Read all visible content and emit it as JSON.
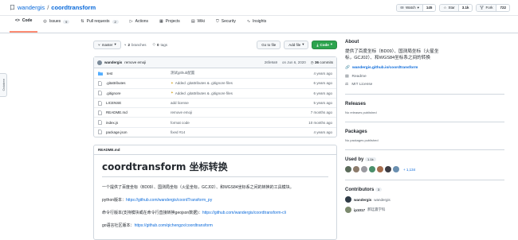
{
  "repo": {
    "owner": "wandergis",
    "separator": "/",
    "name": "coordtransform"
  },
  "actions": {
    "watch_label": "Watch",
    "watch_count": "145",
    "star_label": "Star",
    "star_count": "3.1k",
    "fork_label": "Fork",
    "fork_count": "722"
  },
  "tabs": [
    {
      "label": "Code",
      "icon": "code-icon"
    },
    {
      "label": "Issues",
      "count": "9",
      "icon": "issue-icon"
    },
    {
      "label": "Pull requests",
      "count": "2",
      "icon": "pull-request-icon"
    },
    {
      "label": "Actions",
      "icon": "play-icon"
    },
    {
      "label": "Projects",
      "icon": "table-icon"
    },
    {
      "label": "Wiki",
      "icon": "book-icon"
    },
    {
      "label": "Security",
      "icon": "shield-icon"
    },
    {
      "label": "Insights",
      "icon": "graph-icon"
    }
  ],
  "toolbar": {
    "branch": "master",
    "branches": "2",
    "branches_label": "branches",
    "tags": "0",
    "tags_label": "tags",
    "goto_file": "Go to file",
    "add_file": "Add file",
    "code": "Code"
  },
  "latest_commit": {
    "author": "wandergis",
    "message": "remove emoji",
    "sha": "26fe9a9",
    "date": "on Jun 6, 2020",
    "commits": "36",
    "commits_label": "commits"
  },
  "files": [
    {
      "name": "test",
      "type": "dir",
      "message": "测试github配置",
      "age": "4 years ago"
    },
    {
      "name": ".gitattributes",
      "type": "file",
      "message": "Added .gitattributes & .gitignore files",
      "emoji": true,
      "age": "6 years ago"
    },
    {
      "name": ".gitignore",
      "type": "file",
      "message": "Added .gitattributes & .gitignore files",
      "emoji": true,
      "age": "6 years ago"
    },
    {
      "name": "LICENSE",
      "type": "file",
      "message": "add license",
      "age": "5 years ago"
    },
    {
      "name": "README.md",
      "type": "file",
      "message": "remove emoji",
      "age": "7 months ago"
    },
    {
      "name": "index.js",
      "type": "file",
      "message": "format code",
      "age": "10 months ago"
    },
    {
      "name": "package.json",
      "type": "file",
      "message": "fixed #14",
      "age": "4 years ago"
    }
  ],
  "readme": {
    "header": "README.md",
    "title": "coordtransform 坐标转换",
    "intro": "一个提供了百度坐标（BD09）、国测局坐标（火星坐标，GCJ02）、和WGS84坐标系之间的转换的工具模块。",
    "python_label": "python版本：",
    "python_url": "https://github.com/wandergis/coordTransform_py",
    "cli_label": "命令行版本(支持模块或在命令行直接转换geojson数据)：",
    "cli_url": "https://github.com/wandergis/coordtransform-cli",
    "go_label": "go语言社区版本：",
    "go_url": "https://github.com/qichengzx/coordtransform"
  },
  "sidebar": {
    "about_title": "About",
    "description": "提供了百度坐标（BD09）、国测局坐标（火星坐标，GCJ02）、和WGS84坐标系之间的转换",
    "website": "wandergis.github.io/coordtransform",
    "readme_label": "Readme",
    "license_label": "MIT License",
    "releases_title": "Releases",
    "releases_empty": "No releases published",
    "packages_title": "Packages",
    "packages_empty": "No packages published",
    "used_by_title": "Used by",
    "used_by_count": "1.1k",
    "used_by_more": "+ 1,134",
    "contributors_title": "Contributors",
    "contributors_count": "3",
    "contributors": [
      {
        "login": "wandergis",
        "name": "wandergis"
      },
      {
        "login": "ip1017",
        "name": "郝廷瀛学科"
      }
    ]
  },
  "side_tab": "Octotree",
  "colors": {
    "accent": "#0969da",
    "green": "#2da44e",
    "tab_underline": "#fd8c73"
  }
}
